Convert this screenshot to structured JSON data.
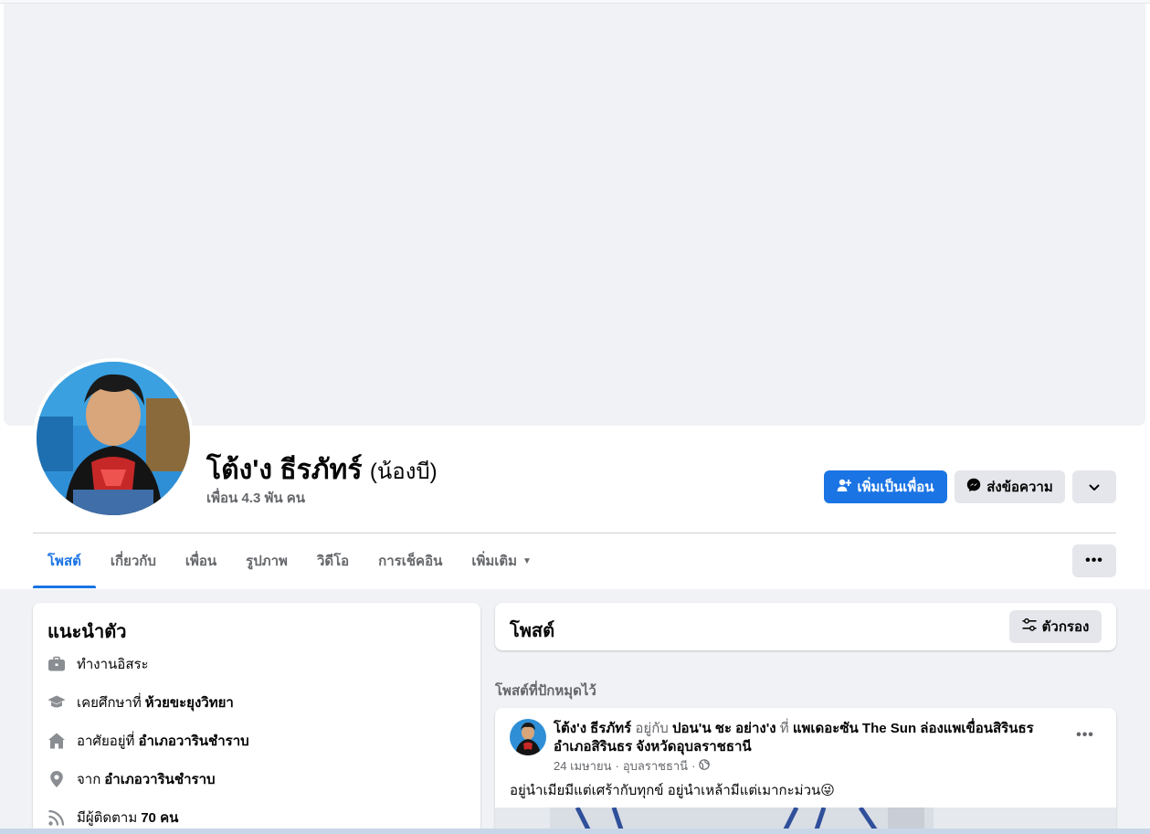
{
  "profile": {
    "name": "โต้ง'ง ธีรภัทร์",
    "nickname": "(น้องบี)",
    "friends_count": "เพื่อน 4.3 พัน คน"
  },
  "actions": {
    "add_friend": "เพิ่มเป็นเพื่อน",
    "message": "ส่งข้อความ"
  },
  "tabs": [
    {
      "label": "โพสต์"
    },
    {
      "label": "เกี่ยวกับ"
    },
    {
      "label": "เพื่อน"
    },
    {
      "label": "รูปภาพ"
    },
    {
      "label": "วิดีโอ"
    },
    {
      "label": "การเช็คอิน"
    },
    {
      "label": "เพิ่มเติม"
    }
  ],
  "intro": {
    "title": "แนะนำตัว",
    "items": [
      {
        "icon": "briefcase-icon",
        "text": "ทำงานอิสระ",
        "bold": ""
      },
      {
        "icon": "graduation-cap-icon",
        "text": "เคยศึกษาที่",
        "bold": "ห้วยขะยุงวิทยา"
      },
      {
        "icon": "home-icon",
        "text": "อาศัยอยู่ที่",
        "bold": "อำเภอวารินชำราบ"
      },
      {
        "icon": "location-pin-icon",
        "text": "จาก",
        "bold": "อำเภอวารินชำราบ"
      },
      {
        "icon": "rss-icon",
        "text": "มีผู้ติดตาม",
        "bold": "70 คน"
      }
    ]
  },
  "posts": {
    "title": "โพสต์",
    "filter_label": "ตัวกรอง",
    "pinned_label": "โพสต์ที่ปักหมุดไว้"
  },
  "post": {
    "author": "โต้ง'ง ธีรภัทร์",
    "with_word": "อยู่กับ",
    "with_person": "ปอน'น ชะ อย่าง'ง",
    "at_word": "ที่",
    "place": "แพเดอะซัน The Sun ล่องแพเขื่อนสิรินธร อำเภอสิรินธร จังหวัดอุบลราชธานี",
    "date": "24 เมษายน",
    "location": "อุบลราชธานี",
    "separator": "·",
    "text": "อยู่นำเมียมีแต่เศร้ากับทุกข์ อยู่นำเหล้ามีแต่เมากะม่วน😜"
  },
  "colors": {
    "accent": "#1b74e4",
    "background": "#f0f2f5",
    "text_secondary": "#65676b"
  }
}
